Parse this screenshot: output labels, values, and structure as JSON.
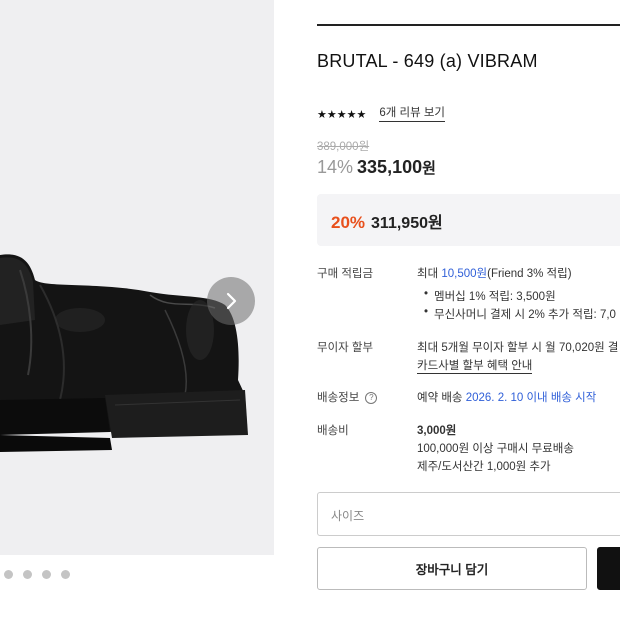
{
  "product": {
    "title": "BRUTAL - 649 (a) VIBRAM",
    "stars": "★★★★★",
    "review_link": "6개 리뷰 보기",
    "original_price": "389,000원",
    "discount_rate": "14%",
    "sale_price": "335,100",
    "sale_currency": "원",
    "promo_rate": "20%",
    "promo_price": "311,950원"
  },
  "gallery": {
    "next_icon": "chevron-right-icon",
    "dot_count": 4
  },
  "details": {
    "points_label": "구매 적립금",
    "points_prefix": "최대 ",
    "points_amount": "10,500원",
    "points_suffix": "(Friend 3% 적립)",
    "points_bullet1": "멤버십 1% 적립: 3,500원",
    "points_bullet2": "무신사머니 결제 시 2% 추가 적립: 7,0",
    "installment_label": "무이자 할부",
    "installment_text": "최대 5개월 무이자 할부 시 월 70,020원 결",
    "installment_link": "카드사별 할부 혜택 안내",
    "shipping_label": "배송정보",
    "shipping_help": "?",
    "shipping_prefix": "예약 배송 ",
    "shipping_date": "2026. 2. 10 이내 배송 시작",
    "fee_label": "배송비",
    "fee_amount": "3,000원",
    "fee_free": "100,000원 이상 구매시 무료배송",
    "fee_island": "제주/도서산간 1,000원 추가"
  },
  "options": {
    "size_placeholder": "사이즈"
  },
  "actions": {
    "cart_label": "장바구니 담기"
  },
  "colors": {
    "promo_accent": "#e8501c",
    "link_blue": "#2f5fd8"
  }
}
